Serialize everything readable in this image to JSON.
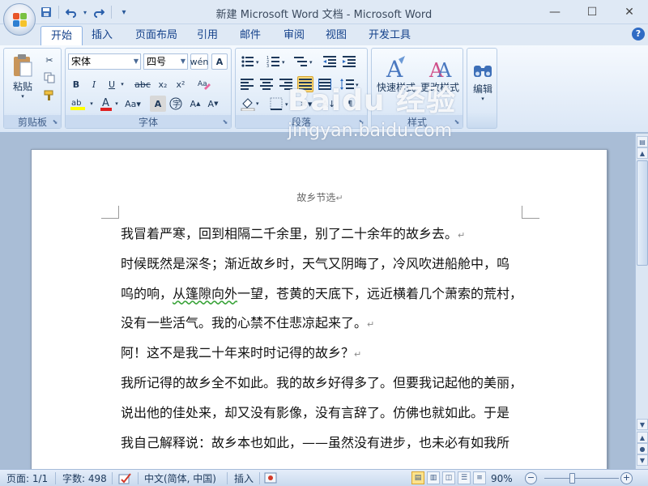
{
  "window": {
    "title": "新建 Microsoft Word 文档 - Microsoft Word",
    "min_icon": "minimize-icon",
    "max_icon": "maximize-icon",
    "close_icon": "close-icon"
  },
  "qat": {
    "save_icon": "save-icon",
    "undo_icon": "undo-icon",
    "redo_icon": "redo-icon",
    "customize_icon": "customize-qat-icon"
  },
  "tabs": [
    "开始",
    "插入",
    "页面布局",
    "引用",
    "邮件",
    "审阅",
    "视图",
    "开发工具"
  ],
  "ribbon": {
    "clipboard": {
      "label": "剪贴板",
      "paste": "粘贴"
    },
    "font": {
      "label": "字体",
      "font_name": "宋体",
      "font_size": "四号"
    },
    "paragraph": {
      "label": "段落"
    },
    "styles": {
      "label": "样式",
      "quick_styles": "快速样式",
      "change_styles": "更改样式"
    },
    "editing": {
      "label": "编辑"
    }
  },
  "watermark": {
    "main": "Baidu 经验",
    "sub": "jingyan.baidu.com"
  },
  "document": {
    "header": "故乡节选",
    "lines": [
      "我冒着严寒，回到相隔二千余里，别了二十余年的故乡去。",
      "时候既然是深冬；渐近故乡时，天气又阴晦了，冷风吹进船舱中，呜",
      "呜的响，从篷隙向外一望，苍黄的天底下，远近横着几个萧索的荒村，",
      "没有一些活气。我的心禁不住悲凉起来了。",
      "阿！这不是我二十年来时时记得的故乡？",
      "我所记得的故乡全不如此。我的故乡好得多了。但要我记起他的美丽，",
      "说出他的佳处来，却又没有影像，没有言辞了。仿佛也就如此。于是",
      "我自己解释说：故乡本也如此，——虽然没有进步，也未必有如我所"
    ],
    "squiggle_text": "从篷隙向外"
  },
  "status": {
    "page": "页面: 1/1",
    "words": "字数: 498",
    "language": "中文(简体, 中国)",
    "mode": "插入",
    "zoom": "90%"
  }
}
